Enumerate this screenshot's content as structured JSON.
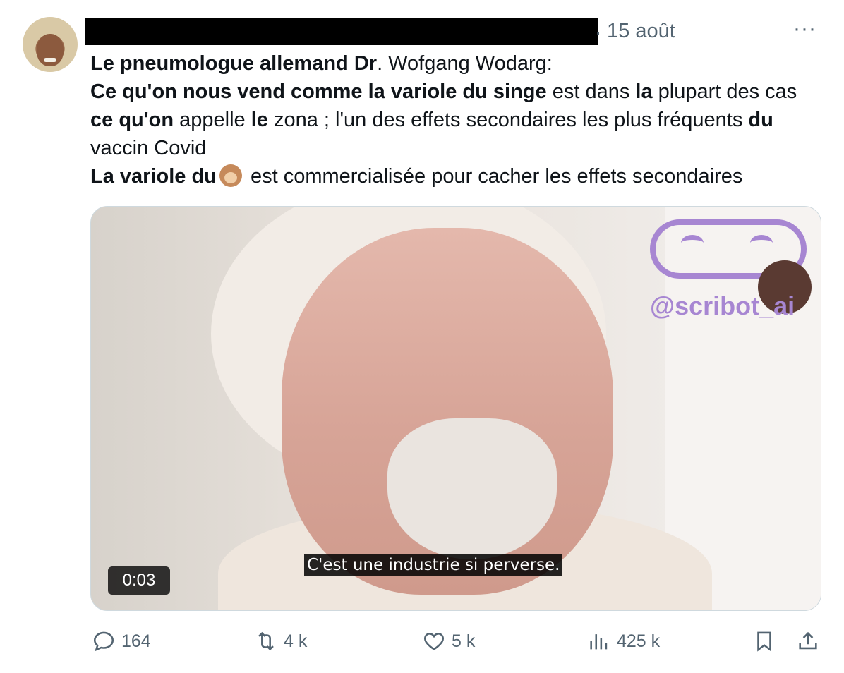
{
  "tweet": {
    "time": "15 août",
    "more": "···",
    "line1_bold": "Le pneumologue allemand Dr",
    "line1_rest": ". Wofgang Wodarg:",
    "line2": [
      {
        "b": "Ce qu'on nous vend comme la variole du singe"
      },
      {
        "t": " est dans "
      },
      {
        "b": "la"
      },
      {
        "t": " plupart des cas "
      },
      {
        "b": "ce qu'on"
      },
      {
        "t": " appelle "
      },
      {
        "b": "le"
      },
      {
        "t": " zona ; l'un des effets secondaires les plus fréquents "
      },
      {
        "b": "du"
      },
      {
        "t": " vaccin Covid"
      }
    ],
    "line3_bold": "La variole du",
    "line3_rest": " est commercialisée pour cacher les effets secondaires"
  },
  "media": {
    "watermark": "@scribot_ai",
    "subtitle": "C'est une industrie si perverse.",
    "duration": "0:03"
  },
  "actions": {
    "replies": "164",
    "reposts": "4 k",
    "likes": "5 k",
    "views": "425 k"
  },
  "colors": {
    "text": "#0f1419",
    "secondary": "#536471",
    "watermark": "#a786d2"
  }
}
